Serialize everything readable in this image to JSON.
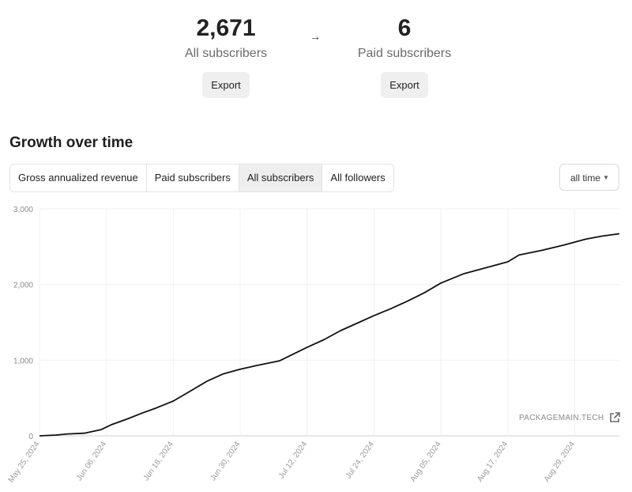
{
  "stats": {
    "all": {
      "value": "2,671",
      "label": "All subscribers",
      "export_label": "Export"
    },
    "arrow": "→",
    "paid": {
      "value": "6",
      "label": "Paid subscribers",
      "export_label": "Export"
    }
  },
  "section_title": "Growth over time",
  "tabs": [
    {
      "label": "Gross annualized revenue",
      "active": false
    },
    {
      "label": "Paid subscribers",
      "active": false
    },
    {
      "label": "All subscribers",
      "active": true
    },
    {
      "label": "All followers",
      "active": false
    }
  ],
  "range_select": {
    "value": "all time",
    "caret": "▼"
  },
  "watermark": {
    "text": "PACKAGEMAIN.TECH",
    "icon": "external-link-icon"
  },
  "chart_data": {
    "type": "line",
    "title": "",
    "xlabel": "",
    "ylabel": "",
    "ylim": [
      0,
      3000
    ],
    "yticks": [
      0,
      1000,
      2000,
      3000
    ],
    "ytick_labels": [
      "0",
      "1,000",
      "2,000",
      "3,000"
    ],
    "xlim": [
      "2024-05-25",
      "2024-09-06"
    ],
    "xticks": [
      "2024-05-25",
      "2024-06-06",
      "2024-06-18",
      "2024-06-30",
      "2024-07-12",
      "2024-07-24",
      "2024-08-05",
      "2024-08-17",
      "2024-08-29"
    ],
    "xtick_labels": [
      "May 25, 2024",
      "Jun 06, 2024",
      "Jun 18, 2024",
      "Jun 30, 2024",
      "Jul 12, 2024",
      "Jul 24, 2024",
      "Aug 05, 2024",
      "Aug 17, 2024",
      "Aug 29, 2024"
    ],
    "grid": true,
    "line_color": "#111111",
    "series": [
      {
        "x": [
          "2024-05-25",
          "2024-05-28",
          "2024-05-30",
          "2024-06-02",
          "2024-06-05",
          "2024-06-07",
          "2024-06-10",
          "2024-06-12",
          "2024-06-15",
          "2024-06-18",
          "2024-06-21",
          "2024-06-24",
          "2024-06-27",
          "2024-06-30",
          "2024-07-03",
          "2024-07-07",
          "2024-07-12",
          "2024-07-15",
          "2024-07-18",
          "2024-07-21",
          "2024-07-24",
          "2024-07-27",
          "2024-07-30",
          "2024-08-02",
          "2024-08-05",
          "2024-08-09",
          "2024-08-13",
          "2024-08-17",
          "2024-08-19",
          "2024-08-23",
          "2024-08-27",
          "2024-08-31",
          "2024-09-03",
          "2024-09-06"
        ],
        "y": [
          0,
          10,
          25,
          35,
          80,
          150,
          230,
          290,
          370,
          460,
          590,
          720,
          820,
          880,
          930,
          990,
          1170,
          1270,
          1390,
          1490,
          1590,
          1680,
          1780,
          1890,
          2020,
          2140,
          2220,
          2300,
          2390,
          2450,
          2520,
          2600,
          2640,
          2671
        ]
      }
    ]
  }
}
